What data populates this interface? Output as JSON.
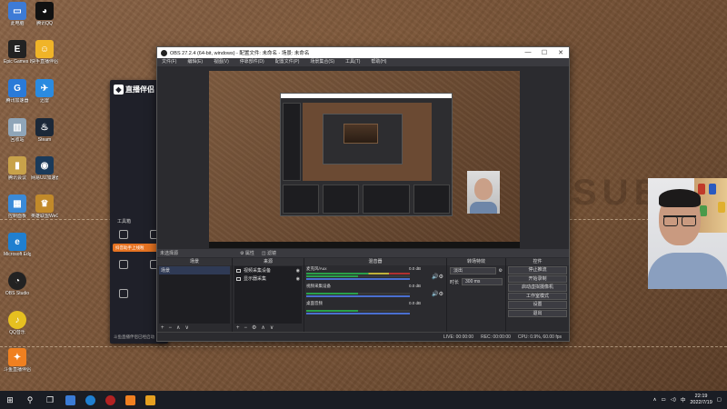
{
  "desktop": {
    "watermark": "SUE",
    "icons": [
      {
        "label": "此电脑",
        "color": "#3d7bd6",
        "glyph": "▭"
      },
      {
        "label": "腾讯QQ",
        "color": "#111111",
        "glyph": "🐧"
      },
      {
        "label": "Epic Games Launcher",
        "color": "#222222",
        "glyph": "E"
      },
      {
        "label": "快手直播伴侣",
        "color": "#f0b428",
        "glyph": "☺"
      },
      {
        "label": "腾讯加速器",
        "color": "#2a7ad8",
        "glyph": "G"
      },
      {
        "label": "迅雷",
        "color": "#2a8be0",
        "glyph": "✈"
      },
      {
        "label": "回收站",
        "color": "#8fa5b8",
        "glyph": "🗑"
      },
      {
        "label": "Steam",
        "color": "#1b2838",
        "glyph": "♨"
      },
      {
        "label": "腾讯会议",
        "color": "#c8a24a",
        "glyph": "▮"
      },
      {
        "label": "网易UU加速器",
        "color": "#1a3a5a",
        "glyph": "◉"
      },
      {
        "label": "控制面板",
        "color": "#3a8ad8",
        "glyph": "▦"
      },
      {
        "label": "英雄联盟WeGame",
        "color": "#c28a2a",
        "glyph": "♛"
      },
      {
        "label": "Microsoft Edge",
        "color": "#1f7fd0",
        "glyph": "e"
      },
      {
        "label": "OBS Studio",
        "color": "#222222",
        "glyph": "◔"
      },
      {
        "label": "QQ音乐",
        "color": "#e6c020",
        "glyph": "♪"
      },
      {
        "label": "斗鱼直播伴侣",
        "color": "#f08020",
        "glyph": "✦"
      }
    ]
  },
  "companion_app": {
    "logo_text": "直播伴侣",
    "tools_label": "工具箱",
    "banner_text": "抖音助手上线啦",
    "status_text": "斗鱼直播伴侣已经启动"
  },
  "obs": {
    "title": "OBS 27.2.4 (64-bit, windows) - 配置文件: 未命名 - 场景: 未命名",
    "window_buttons": [
      "—",
      "☐",
      "✕"
    ],
    "menu": [
      "文件(F)",
      "编辑(E)",
      "视图(V)",
      "停靠部件(D)",
      "配置文件(P)",
      "场景集合(S)",
      "工具(T)",
      "帮助(H)"
    ],
    "toolbar_label": "未选择源",
    "toolbar_buttons": [
      "⚙ 属性",
      "◫ 滤镜"
    ],
    "docks": {
      "scenes": {
        "title": "场景",
        "items": [
          "场景"
        ],
        "footer": [
          "+",
          "−",
          "∧",
          "∨"
        ]
      },
      "sources": {
        "title": "来源",
        "items": [
          {
            "name": "视频采集设备"
          },
          {
            "name": "显示器采集"
          }
        ],
        "footer": [
          "+",
          "−",
          "⚙",
          "∧",
          "∨"
        ]
      },
      "mixer": {
        "title": "混音器",
        "channels": [
          {
            "name": "麦克风/Aux",
            "db": "0.0 dB"
          },
          {
            "name": "视频采集设备",
            "db": "0.0 dB"
          },
          {
            "name": "桌面音频",
            "db": "0.0 dB"
          }
        ]
      },
      "transitions": {
        "title": "转场特效",
        "type": "淡出",
        "duration_label": "时长",
        "duration": "300 ms"
      },
      "controls": {
        "title": "控件",
        "buttons": [
          "停止推流",
          "开始录制",
          "启动虚拟摄像机",
          "工作室模式",
          "设置",
          "退出"
        ]
      }
    },
    "status": {
      "live": "LIVE: 00:00:00",
      "rec": "REC: 00:00:00",
      "cpu": "CPU: 0.9%, 60.00 fps"
    }
  },
  "taskbar": {
    "start_glyph": "⊞",
    "search_glyph": "⚲",
    "taskview_glyph": "❐",
    "apps": [
      "#3a7bd5",
      "#1f7fd0",
      "#b22222",
      "#f08020",
      "#e6a020"
    ],
    "tray": {
      "caret": "∧",
      "ime": "中",
      "time": "22:19",
      "date": "2022/7/19"
    }
  }
}
